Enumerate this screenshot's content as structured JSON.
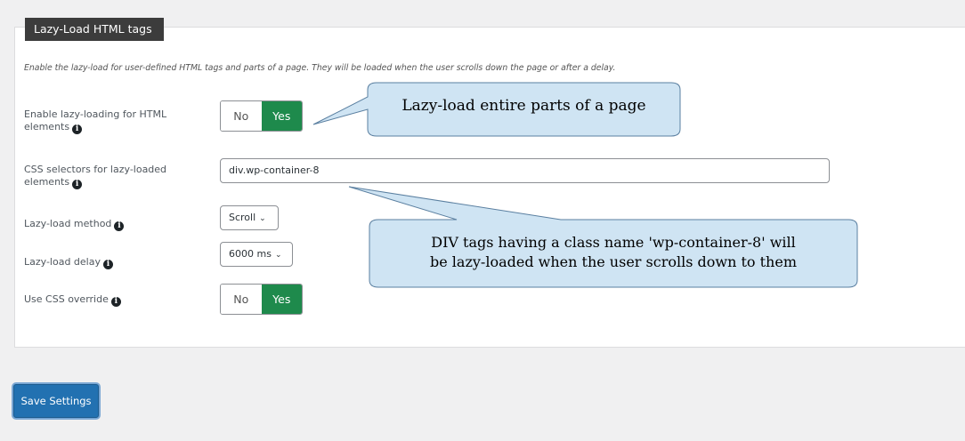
{
  "section": {
    "title": "Lazy-Load HTML tags",
    "description": "Enable the lazy-load for user-defined HTML tags and parts of a page. They will be loaded when the user scrolls down the page or after a delay."
  },
  "fields": {
    "enable_lazy": {
      "label_line1": "Enable lazy-loading for HTML",
      "label_line2": "elements",
      "no": "No",
      "yes": "Yes",
      "selected": "Yes"
    },
    "css_selectors": {
      "label_line1": "CSS selectors for lazy-loaded",
      "label_line2": "elements",
      "value": "div.wp-container-8"
    },
    "method": {
      "label": "Lazy-load method",
      "value": "Scroll"
    },
    "delay": {
      "label": "Lazy-load delay",
      "value": "6000 ms"
    },
    "css_override": {
      "label": "Use CSS override",
      "no": "No",
      "yes": "Yes",
      "selected": "Yes"
    }
  },
  "info_icon_glyph": "i",
  "chevron_glyph": "⌄",
  "callouts": {
    "first": "Lazy-load entire parts of a page",
    "second_line1": "DIV tags having a class name 'wp-container-8' will",
    "second_line2": "be lazy-loaded when the user scrolls down to them"
  },
  "save_button": "Save Settings",
  "colors": {
    "toggle_active": "#1e8a4c",
    "save_button": "#2271b1",
    "callout_fill": "#cfe4f3",
    "section_tab": "#3c3c3c"
  }
}
